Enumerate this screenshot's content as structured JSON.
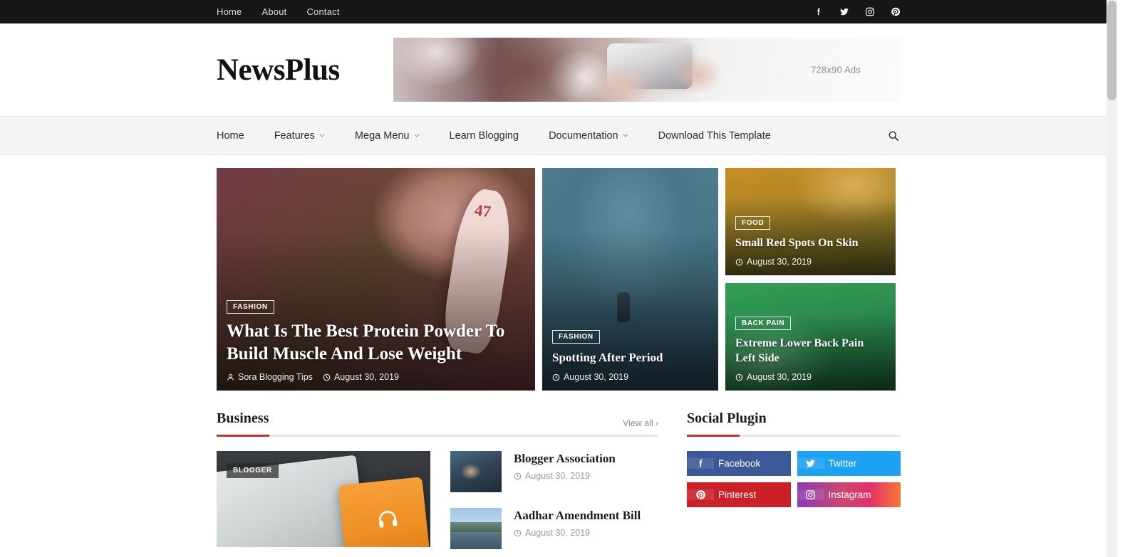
{
  "topbar": {
    "nav": [
      {
        "label": "Home"
      },
      {
        "label": "About"
      },
      {
        "label": "Contact"
      }
    ],
    "social": [
      {
        "name": "facebook-icon"
      },
      {
        "name": "twitter-icon"
      },
      {
        "name": "instagram-icon"
      },
      {
        "name": "pinterest-icon"
      }
    ]
  },
  "header": {
    "logo": "NewsPlus",
    "ad_label": "728x90 Ads"
  },
  "mainnav": {
    "items": [
      {
        "label": "Home",
        "dropdown": false
      },
      {
        "label": "Features",
        "dropdown": true
      },
      {
        "label": "Mega Menu",
        "dropdown": true
      },
      {
        "label": "Learn Blogging",
        "dropdown": false
      },
      {
        "label": "Documentation",
        "dropdown": true
      },
      {
        "label": "Download This Template",
        "dropdown": false
      }
    ],
    "search_icon": "search-icon"
  },
  "featured": {
    "main": {
      "category": "FASHION",
      "title": "What Is The Best Protein Powder To Build Muscle And Lose Weight",
      "author": "Sora Blogging Tips",
      "date": "August 30, 2019",
      "jersey_number": "47"
    },
    "middle": {
      "category": "FASHION",
      "title": "Spotting After Period",
      "date": "August 30, 2019"
    },
    "top_right": {
      "category": "FOOD",
      "title": "Small Red Spots On Skin",
      "date": "August 30, 2019"
    },
    "bottom_right": {
      "category": "BACK PAIN",
      "title": "Extreme Lower Back Pain Left Side",
      "date": "August 30, 2019"
    }
  },
  "business": {
    "heading": "Business",
    "view_all": "View all",
    "view_all_chevron": "›",
    "featured": {
      "badge": "BLOGGER"
    },
    "posts": [
      {
        "title": "Blogger Association",
        "date": "August 30, 2019"
      },
      {
        "title": "Aadhar Amendment Bill",
        "date": "August 30, 2019"
      }
    ]
  },
  "social_plugin": {
    "heading": "Social Plugin",
    "buttons": [
      {
        "label": "Facebook",
        "icon": "facebook-icon",
        "color": "#3b5998"
      },
      {
        "label": "Twitter",
        "icon": "twitter-icon",
        "color": "#1da1f2"
      },
      {
        "label": "Pinterest",
        "icon": "pinterest-icon",
        "color": "#cb2027"
      },
      {
        "label": "Instagram",
        "icon": "instagram-icon",
        "color": "#e1306c"
      }
    ]
  },
  "theme": {
    "accent": "#d42f2f",
    "topbar_bg": "#161616",
    "nav_bg": "#f4f4f4"
  }
}
